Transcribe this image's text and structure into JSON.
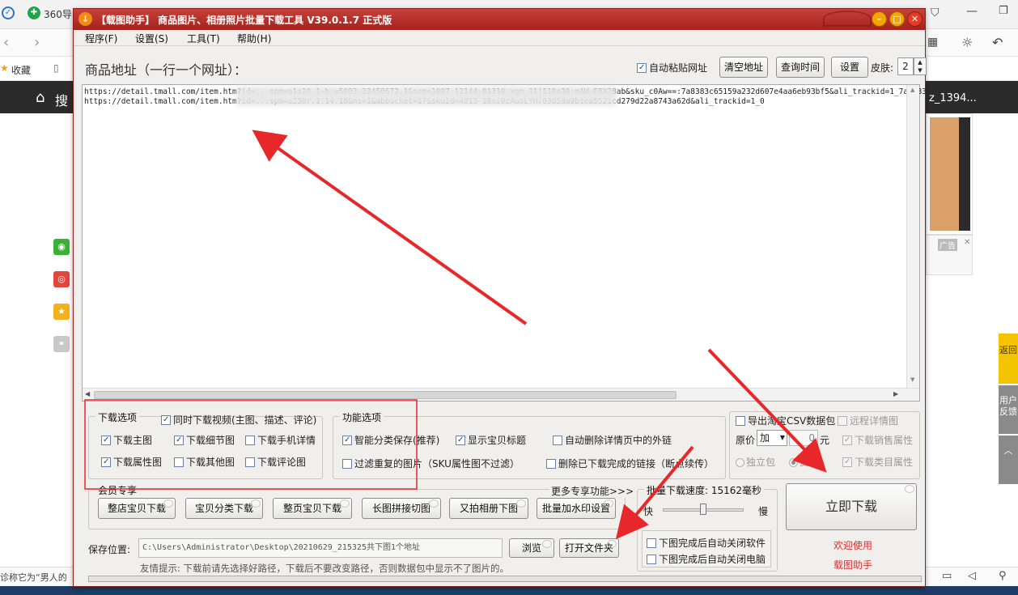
{
  "browser": {
    "tab_label": "360导",
    "bookmark_label": "收藏",
    "search_fragment": "搜",
    "product_fragment": "z_1394...",
    "status_fragment": "诊称它为“男人的",
    "ad_label": "广告",
    "side_tab_1": "返回",
    "side_tab_2": "用户反馈"
  },
  "app": {
    "title": "【载图助手】 商品图片、相册照片批量下载工具 V39.0.1.7 正式版",
    "menu": [
      "程序(F)",
      "设置(S)",
      "工具(T)",
      "帮助(H)"
    ],
    "url_label": "商品地址（一行一个网址）：",
    "auto_paste": "自动粘贴网址",
    "clear_btn": "清空地址",
    "query_time_btn": "查询时间",
    "settings_btn": "设置",
    "skin_label": "皮肤:",
    "skin_value": "2",
    "urls": [
      "https://detail.tmall.com/item.htm?id=...spm=a1z10.1-b.w5003-23450672.1&scm=1007.12144.81310.xgn_31|118a30:mAW-F8X28ab&sku_c0Aw==:7a8383c65159a232d607e4aa6eb93bf5&ali_trackid=1_7a8383c",
      "https://detail.tmall.com/item.htm?id=...spm=a230r.1.14.18&ns=1&abbucket=17&skuId=4813 18xi0zAuoLYH:03d5da9b1ea5521cd279d22a8743a62d&ali_trackid=1_0"
    ],
    "download_options": {
      "title": "下载选项",
      "video": "同时下载视频(主图、描述、评论)",
      "main_img": "下载主图",
      "detail_img": "下载细节图",
      "mobile_detail": "下载手机详情",
      "attr_img": "下载属性图",
      "other_img": "下载其他图",
      "comment_img": "下载评论图"
    },
    "function_options": {
      "title": "功能选项",
      "smart_save": "智能分类保存(推荐)",
      "show_title": "显示宝贝标题",
      "auto_delete_links": "自动删除详情页中的外链",
      "filter_dup": "过滤重复的图片（SKU属性图不过滤）",
      "delete_done": "删除已下载完成的链接（断点续传）"
    },
    "export": {
      "csv": "导出淘宝CSV数据包",
      "remote_detail": "远程详情图",
      "orig_price": "原价",
      "price_op": "加",
      "price_val": "0",
      "price_unit": "元",
      "sales_attr": "下载销售属性",
      "single_pkg": "独立包",
      "merge_pkg": "复制",
      "category_attr": "下载类目属性"
    },
    "member": {
      "title": "会员专享",
      "more": "更多专享功能>>>",
      "buttons": [
        "整店宝贝下载",
        "宝贝分类下载",
        "整页宝贝下载",
        "长图拼接切图",
        "又拍相册下图",
        "批量加水印设置"
      ]
    },
    "speed": {
      "title": "批量下载速度: 15162毫秒",
      "fast": "快",
      "slow": "慢",
      "value_fraction": 0.5,
      "auto_close_app": "下图完成后自动关闭软件",
      "auto_shutdown": "下图完成后自动关闭电脑"
    },
    "download_btn": "立即下载",
    "welcome_1": "欢迎使用",
    "welcome_2": "载图助手",
    "save_label": "保存位置:",
    "save_path": "C:\\Users\\Administrator\\Desktop\\20210629_215325共下图1个地址",
    "browse_btn": "浏览",
    "open_folder_btn": "打开文件夹",
    "tip": "友情提示: 下载前请先选择好路径，下载后不要改变路径，否则数据包中显示不了图片的。"
  },
  "colors": {
    "title_red": "#b0302a",
    "annotation_red": "#e8272a",
    "welcome_red": "#d83030"
  }
}
